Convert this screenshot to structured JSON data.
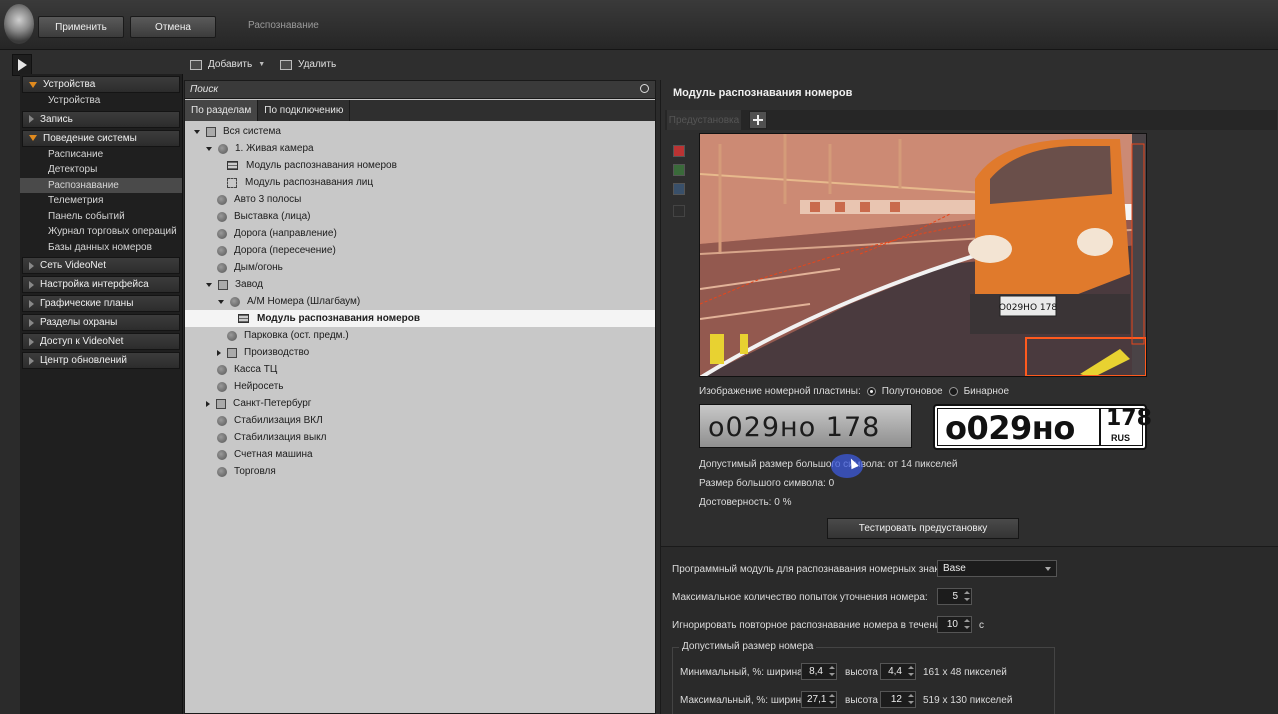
{
  "topbar": {
    "apply_label": "Применить",
    "cancel_label": "Отмена",
    "title": "Распознавание"
  },
  "toolbar": {
    "add_label": "Добавить",
    "delete_label": "Удалить"
  },
  "nav": {
    "devices": {
      "label": "Устройства",
      "items": [
        "Устройства"
      ]
    },
    "record": {
      "label": "Запись"
    },
    "behavior": {
      "label": "Поведение системы",
      "items": [
        "Расписание",
        "Детекторы",
        "Распознавание",
        "Телеметрия",
        "Панель событий",
        "Журнал торговых операций",
        "Базы данных номеров"
      ],
      "selected": "Распознавание"
    },
    "collapsed": [
      "Сеть VideoNet",
      "Настройка интерфейса",
      "Графические планы",
      "Разделы охраны",
      "Доступ к VideoNet",
      "Центр обновлений"
    ]
  },
  "tree_panel": {
    "search_placeholder": "Поиск",
    "tabs": [
      "По разделам",
      "По подключению"
    ],
    "items": [
      {
        "label": "Вся система"
      },
      {
        "label": "1. Живая камера"
      },
      {
        "label": "Модуль распознавания номеров"
      },
      {
        "label": "Модуль распознавания лиц"
      },
      {
        "label": "Авто 3 полосы"
      },
      {
        "label": "Выставка (лица)"
      },
      {
        "label": "Дорога (направление)"
      },
      {
        "label": "Дорога (пересечение)"
      },
      {
        "label": "Дым/огонь"
      },
      {
        "label": "Завод"
      },
      {
        "label": "А/М Номера (Шлагбаум)"
      },
      {
        "label": "Модуль распознавания номеров"
      },
      {
        "label": "Парковка (ост. предм.)"
      },
      {
        "label": "Производство"
      },
      {
        "label": "Касса ТЦ"
      },
      {
        "label": "Нейросеть"
      },
      {
        "label": "Санкт-Петербург"
      },
      {
        "label": "Стабилизация ВКЛ"
      },
      {
        "label": "Стабилизация выкл"
      },
      {
        "label": "Счетная машина"
      },
      {
        "label": "Торговля"
      }
    ]
  },
  "module": {
    "title": "Модуль распознавания номеров",
    "preset_tab": "Предустановка",
    "plate_image_label": "Изображение номерной пластины:",
    "mode_gray": "Полутоновое",
    "mode_binary": "Бинарное",
    "mode_selected": "Полутоновое",
    "plate_photo_text": "o029нo 178",
    "plate_number": "o029нo",
    "plate_region": "178",
    "plate_country": "RUS",
    "car_plate_text": "O029HO 178",
    "allowed_big_symbol": "Допустимый размер большого символа:  от 14 пикселей",
    "big_symbol_size": "Размер большого символа:  0",
    "confidence": "Достоверность:  0 %",
    "test_button": "Тестировать предустановку"
  },
  "settings": {
    "software_module_label": "Программный модуль для распознавания номерных знаков:",
    "software_module_value": "Base",
    "max_attempts_label": "Максимальное количество попыток уточнения номера:",
    "max_attempts_value": "5",
    "ignore_repeat_label": "Игнорировать повторное распознавание номера в течение:",
    "ignore_repeat_value": "10",
    "ignore_repeat_unit": "с",
    "size_group_title": "Допустимый размер номера",
    "min_label": "Минимальный, %: ширина",
    "min_width": "8,4",
    "min_height_label": "высота",
    "min_height": "4,4",
    "min_pixels": "161 x 48 пикселей",
    "max_label": "Максимальный, %: ширина",
    "max_width": "27,1",
    "max_height_label": "высота",
    "max_height": "12",
    "max_pixels": "519 x 130 пикселей"
  },
  "colors": {
    "accent": "#e08a1e",
    "detection": "#e8461a"
  }
}
